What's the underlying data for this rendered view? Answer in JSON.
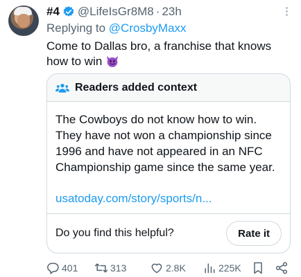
{
  "author": {
    "name": "#4",
    "handle": "@LifeIsGr8M8",
    "separator": "·",
    "time": "23h",
    "verified": true
  },
  "reply": {
    "prefix": "Replying to",
    "to": "@CrosbyMaxx"
  },
  "tweet": {
    "text": "Come to Dallas bro, a franchise that knows how to win",
    "emoji": "devil-face-icon"
  },
  "context_note": {
    "title": "Readers added context",
    "body": "The Cowboys do not know how to win. They have not won a championship since 1996 and have not appeared in an NFC Championship game since the same year.",
    "link": "usatoday.com/story/sports/n...",
    "question": "Do you find this helpful?",
    "rate_label": "Rate it"
  },
  "actions": {
    "replies": "401",
    "retweets": "313",
    "likes": "2.8K",
    "views": "225K"
  },
  "colors": {
    "accent": "#1d9bf0",
    "muted": "#536471",
    "border": "#cfd9de"
  }
}
